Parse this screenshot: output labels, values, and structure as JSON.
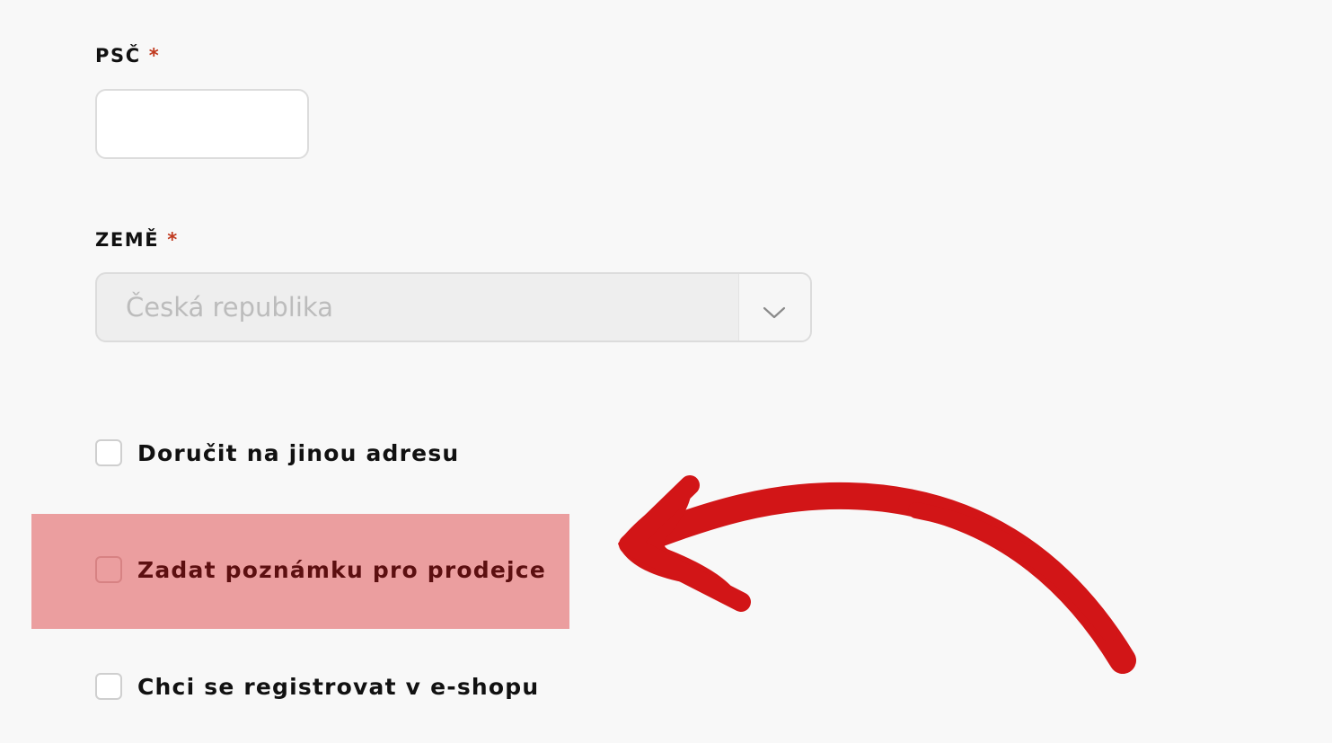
{
  "form": {
    "zip": {
      "label": "PSČ",
      "required_mark": "*",
      "value": ""
    },
    "country": {
      "label": "ZEMĚ",
      "required_mark": "*",
      "selected": "Česká republika",
      "disabled": true
    },
    "checkboxes": [
      {
        "label": "Doručit na jinou adresu",
        "checked": false
      },
      {
        "label": "Zadat poznámku pro prodejce",
        "checked": false,
        "highlighted": true
      },
      {
        "label": "Chci se registrovat v e-shopu",
        "checked": false
      }
    ]
  },
  "annotation": {
    "arrow_icon": "curved-arrow-icon",
    "arrow_color": "#d21517",
    "highlight_color": "#eb9e9f"
  },
  "colors": {
    "required": "#c0391e",
    "background": "#f8f8f8"
  }
}
